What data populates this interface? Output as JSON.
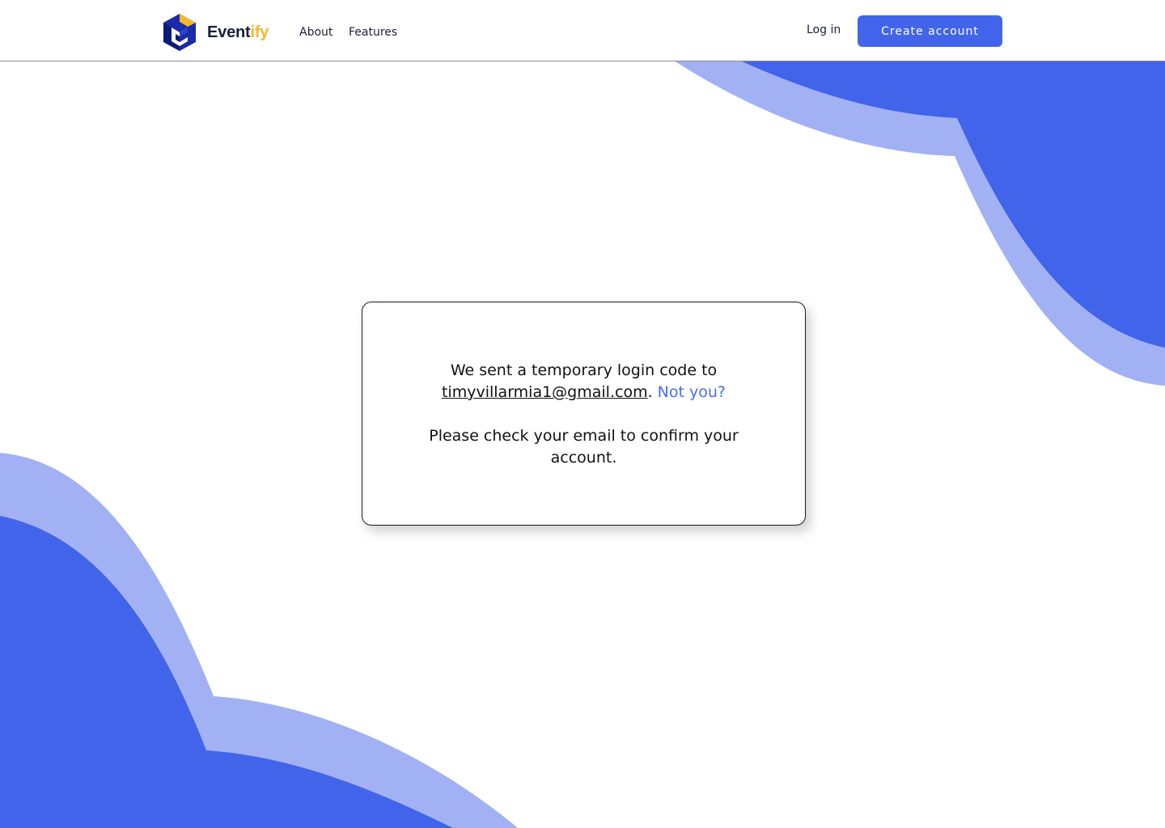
{
  "header": {
    "brand_part1": "Event",
    "brand_part2": "ify",
    "nav": {
      "about": "About",
      "features": "Features"
    },
    "login_label": "Log in",
    "create_account_label": "Create account"
  },
  "card": {
    "line1": "We sent a temporary login code to",
    "email": "timyvillarmia1@gmail.com",
    "period": ".",
    "not_you": "Not you?",
    "line2": "Please check your email to confirm your account."
  },
  "colors": {
    "accent": "#4264ea",
    "accent_light": "#a1b1f4",
    "brand_dark": "#1b1f3b",
    "brand_yellow": "#f6b829",
    "link": "#4a6cf0"
  },
  "icons": {
    "logo": "eventify-cube-logo-icon"
  }
}
